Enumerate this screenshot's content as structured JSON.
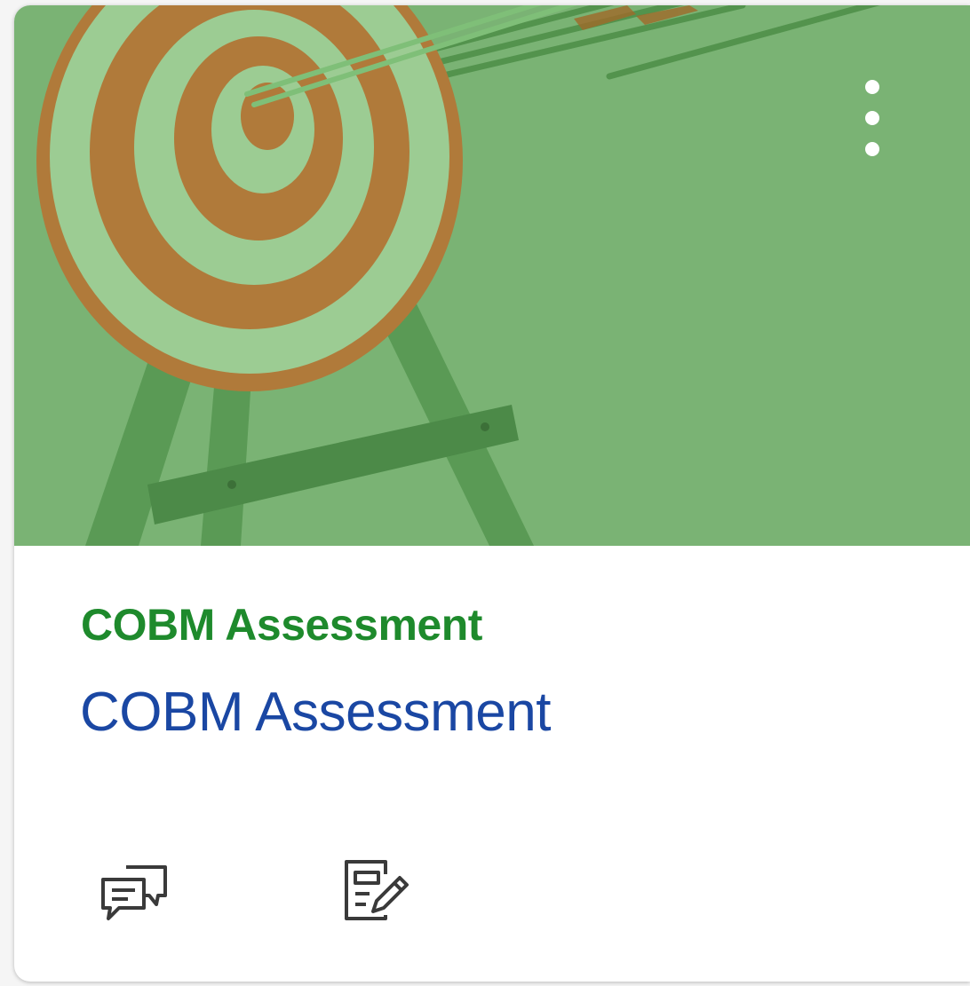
{
  "card": {
    "color": "#7ab374",
    "menu_icon": "kebab-menu-icon",
    "course_code": "COBM Assessment",
    "course_name": "COBM Assessment",
    "code_color": "#1e8a2c",
    "name_color": "#1a47a3",
    "actions": [
      {
        "icon": "discussions-icon"
      },
      {
        "icon": "assignments-icon"
      }
    ]
  }
}
